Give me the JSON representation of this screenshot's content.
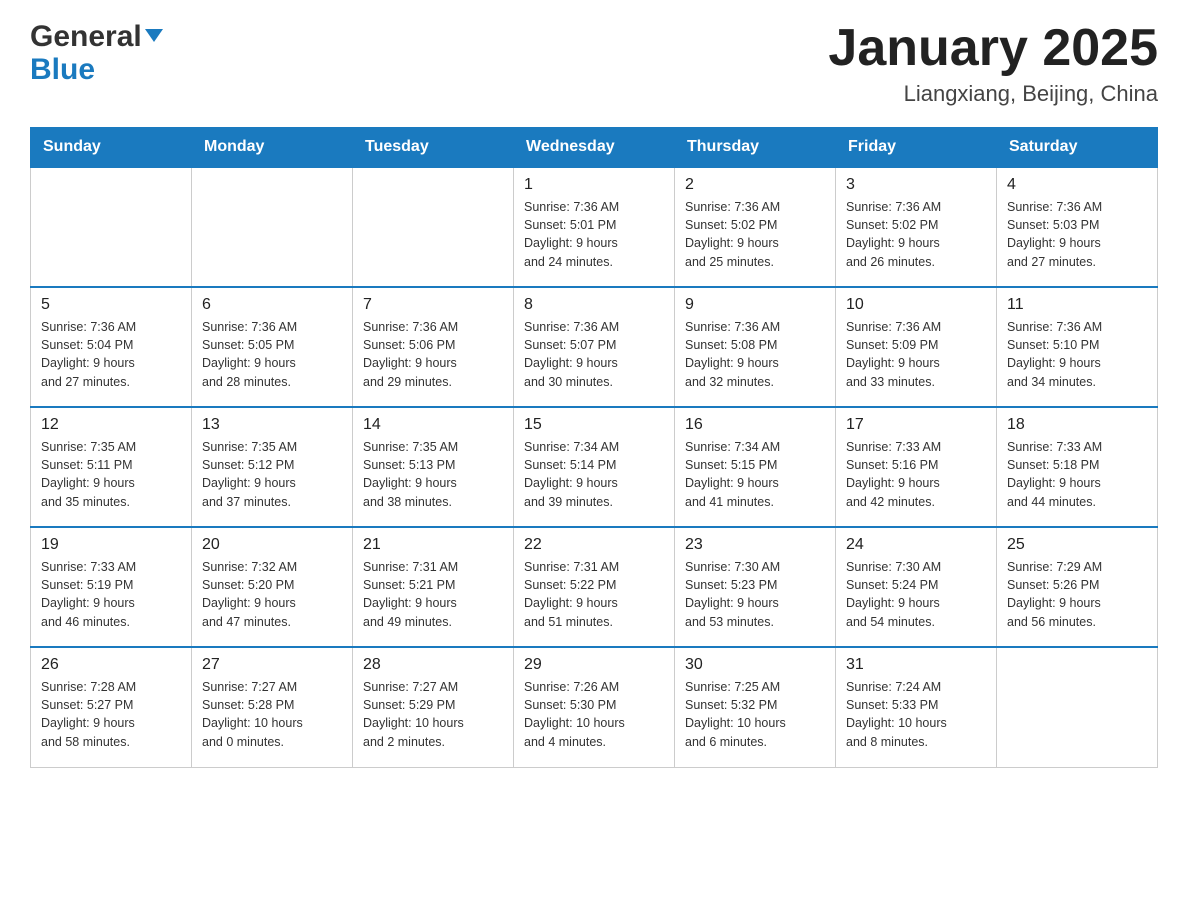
{
  "header": {
    "logo_general": "General",
    "logo_blue": "Blue",
    "title": "January 2025",
    "subtitle": "Liangxiang, Beijing, China"
  },
  "weekdays": [
    "Sunday",
    "Monday",
    "Tuesday",
    "Wednesday",
    "Thursday",
    "Friday",
    "Saturday"
  ],
  "weeks": [
    [
      {
        "day": "",
        "info": ""
      },
      {
        "day": "",
        "info": ""
      },
      {
        "day": "",
        "info": ""
      },
      {
        "day": "1",
        "info": "Sunrise: 7:36 AM\nSunset: 5:01 PM\nDaylight: 9 hours\nand 24 minutes."
      },
      {
        "day": "2",
        "info": "Sunrise: 7:36 AM\nSunset: 5:02 PM\nDaylight: 9 hours\nand 25 minutes."
      },
      {
        "day": "3",
        "info": "Sunrise: 7:36 AM\nSunset: 5:02 PM\nDaylight: 9 hours\nand 26 minutes."
      },
      {
        "day": "4",
        "info": "Sunrise: 7:36 AM\nSunset: 5:03 PM\nDaylight: 9 hours\nand 27 minutes."
      }
    ],
    [
      {
        "day": "5",
        "info": "Sunrise: 7:36 AM\nSunset: 5:04 PM\nDaylight: 9 hours\nand 27 minutes."
      },
      {
        "day": "6",
        "info": "Sunrise: 7:36 AM\nSunset: 5:05 PM\nDaylight: 9 hours\nand 28 minutes."
      },
      {
        "day": "7",
        "info": "Sunrise: 7:36 AM\nSunset: 5:06 PM\nDaylight: 9 hours\nand 29 minutes."
      },
      {
        "day": "8",
        "info": "Sunrise: 7:36 AM\nSunset: 5:07 PM\nDaylight: 9 hours\nand 30 minutes."
      },
      {
        "day": "9",
        "info": "Sunrise: 7:36 AM\nSunset: 5:08 PM\nDaylight: 9 hours\nand 32 minutes."
      },
      {
        "day": "10",
        "info": "Sunrise: 7:36 AM\nSunset: 5:09 PM\nDaylight: 9 hours\nand 33 minutes."
      },
      {
        "day": "11",
        "info": "Sunrise: 7:36 AM\nSunset: 5:10 PM\nDaylight: 9 hours\nand 34 minutes."
      }
    ],
    [
      {
        "day": "12",
        "info": "Sunrise: 7:35 AM\nSunset: 5:11 PM\nDaylight: 9 hours\nand 35 minutes."
      },
      {
        "day": "13",
        "info": "Sunrise: 7:35 AM\nSunset: 5:12 PM\nDaylight: 9 hours\nand 37 minutes."
      },
      {
        "day": "14",
        "info": "Sunrise: 7:35 AM\nSunset: 5:13 PM\nDaylight: 9 hours\nand 38 minutes."
      },
      {
        "day": "15",
        "info": "Sunrise: 7:34 AM\nSunset: 5:14 PM\nDaylight: 9 hours\nand 39 minutes."
      },
      {
        "day": "16",
        "info": "Sunrise: 7:34 AM\nSunset: 5:15 PM\nDaylight: 9 hours\nand 41 minutes."
      },
      {
        "day": "17",
        "info": "Sunrise: 7:33 AM\nSunset: 5:16 PM\nDaylight: 9 hours\nand 42 minutes."
      },
      {
        "day": "18",
        "info": "Sunrise: 7:33 AM\nSunset: 5:18 PM\nDaylight: 9 hours\nand 44 minutes."
      }
    ],
    [
      {
        "day": "19",
        "info": "Sunrise: 7:33 AM\nSunset: 5:19 PM\nDaylight: 9 hours\nand 46 minutes."
      },
      {
        "day": "20",
        "info": "Sunrise: 7:32 AM\nSunset: 5:20 PM\nDaylight: 9 hours\nand 47 minutes."
      },
      {
        "day": "21",
        "info": "Sunrise: 7:31 AM\nSunset: 5:21 PM\nDaylight: 9 hours\nand 49 minutes."
      },
      {
        "day": "22",
        "info": "Sunrise: 7:31 AM\nSunset: 5:22 PM\nDaylight: 9 hours\nand 51 minutes."
      },
      {
        "day": "23",
        "info": "Sunrise: 7:30 AM\nSunset: 5:23 PM\nDaylight: 9 hours\nand 53 minutes."
      },
      {
        "day": "24",
        "info": "Sunrise: 7:30 AM\nSunset: 5:24 PM\nDaylight: 9 hours\nand 54 minutes."
      },
      {
        "day": "25",
        "info": "Sunrise: 7:29 AM\nSunset: 5:26 PM\nDaylight: 9 hours\nand 56 minutes."
      }
    ],
    [
      {
        "day": "26",
        "info": "Sunrise: 7:28 AM\nSunset: 5:27 PM\nDaylight: 9 hours\nand 58 minutes."
      },
      {
        "day": "27",
        "info": "Sunrise: 7:27 AM\nSunset: 5:28 PM\nDaylight: 10 hours\nand 0 minutes."
      },
      {
        "day": "28",
        "info": "Sunrise: 7:27 AM\nSunset: 5:29 PM\nDaylight: 10 hours\nand 2 minutes."
      },
      {
        "day": "29",
        "info": "Sunrise: 7:26 AM\nSunset: 5:30 PM\nDaylight: 10 hours\nand 4 minutes."
      },
      {
        "day": "30",
        "info": "Sunrise: 7:25 AM\nSunset: 5:32 PM\nDaylight: 10 hours\nand 6 minutes."
      },
      {
        "day": "31",
        "info": "Sunrise: 7:24 AM\nSunset: 5:33 PM\nDaylight: 10 hours\nand 8 minutes."
      },
      {
        "day": "",
        "info": ""
      }
    ]
  ]
}
